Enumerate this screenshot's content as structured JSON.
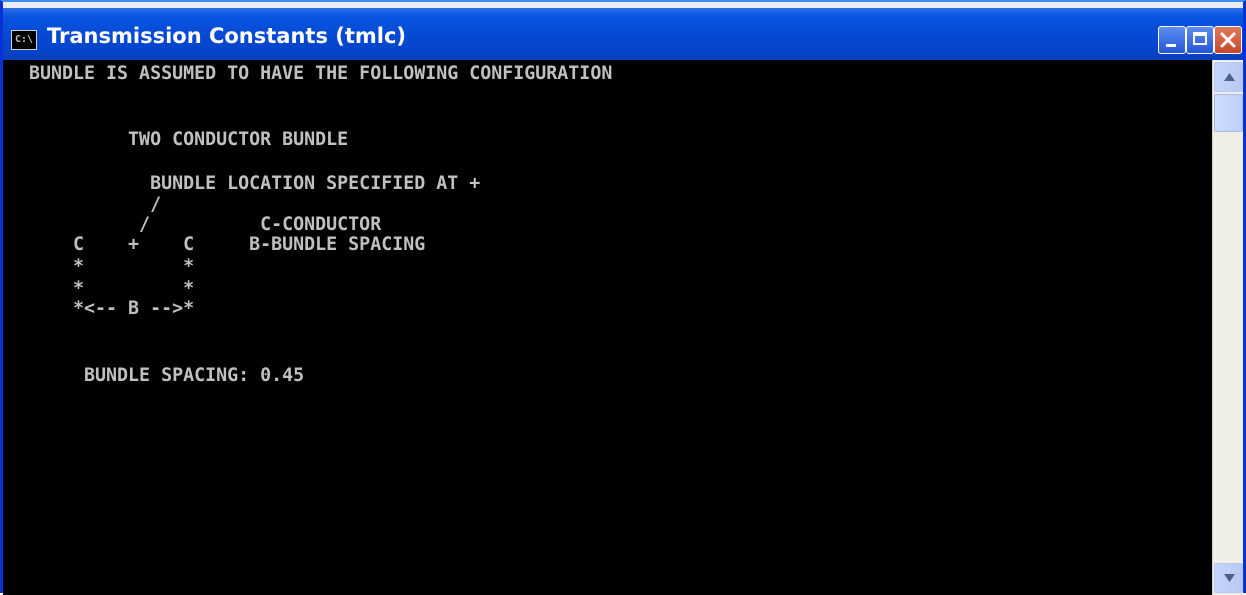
{
  "window": {
    "title": "Transmission Constants (tmlc)",
    "icon_name": "console-icon",
    "icon_text": "C:\\"
  },
  "console": {
    "lines": [
      "BUNDLE IS ASSUMED TO HAVE THE FOLLOWING CONFIGURATION",
      "",
      "         TWO CONDUCTOR BUNDLE",
      "",
      "           BUNDLE LOCATION SPECIFIED AT +",
      "           /",
      "          /          C-CONDUCTOR",
      "    C    +    C     B-BUNDLE SPACING",
      "    *         *",
      "    *         *",
      "    *<-- B -->*",
      "",
      "",
      "     BUNDLE SPACING: 0.45"
    ]
  },
  "colors": {
    "titlebar": "#0a55e0",
    "console_bg": "#000000",
    "console_text": "#c0c0c0"
  }
}
